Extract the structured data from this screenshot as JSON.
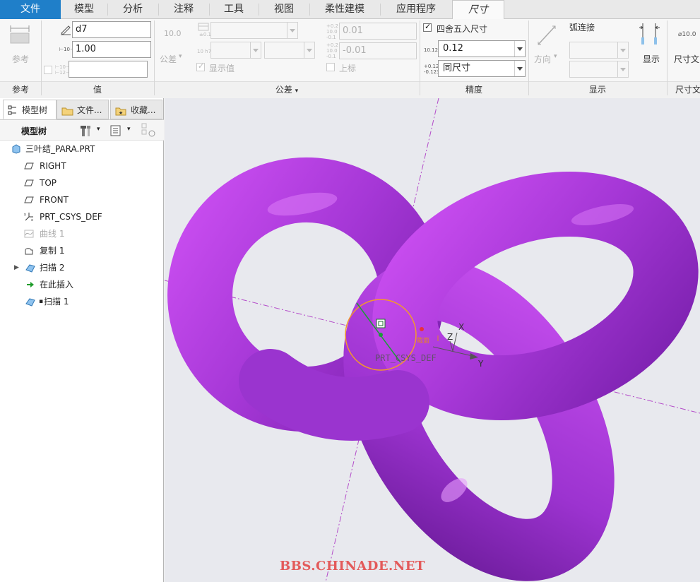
{
  "menubar": {
    "tabs": [
      "文件",
      "模型",
      "分析",
      "注释",
      "工具",
      "视图",
      "柔性建模",
      "应用程序",
      "尺寸"
    ],
    "active": "尺寸",
    "accent": "#1f7fc9"
  },
  "ribbon": {
    "reference": {
      "label": "参考",
      "group": "参考"
    },
    "value": {
      "group": "值",
      "name_field": "d7",
      "value_field": "1.00",
      "name_prefix": "",
      "value_prefix": "⊢10⊣",
      "bottom_prefix": "⊢10⊣ ⊢12⊣",
      "bottom_field": ""
    },
    "tolerance": {
      "group": "公差",
      "sample_value": "10.0",
      "dropdown": "公差",
      "table_label": "±0.1",
      "hole_label": "10 h7",
      "upper_prefix": "+0.2 10.0 -0.1",
      "upper_value": "0.01",
      "lower_prefix": "+0.2 10.0 -0.1",
      "lower_value": "-0.01",
      "show_value": "显示值",
      "upper_check": "上标"
    },
    "precision": {
      "group": "精度",
      "round_label": "四舍五入尺寸",
      "round_checked": true,
      "decimal_prefix": "10.123",
      "decimal_value": "0.12",
      "tol_prefix": "+0.123 -0.123",
      "tol_value": "同尺寸"
    },
    "display": {
      "group": "显示",
      "direction_label": "方向",
      "arc_label": "弧连接",
      "show_label": "显示"
    },
    "dim_text": {
      "group": "尺寸文",
      "label": "尺寸文",
      "prefix": "⌀10.0"
    }
  },
  "left_pane": {
    "tabs": [
      "模型树",
      "文件...",
      "收藏..."
    ],
    "tree_header": "模型树",
    "items": [
      {
        "label": "三叶结_PARA.PRT",
        "icon": "part-icon",
        "disabled": false,
        "expand": false
      },
      {
        "label": "RIGHT",
        "icon": "datum-plane-icon",
        "disabled": false,
        "expand": false
      },
      {
        "label": "TOP",
        "icon": "datum-plane-icon",
        "disabled": false,
        "expand": false
      },
      {
        "label": "FRONT",
        "icon": "datum-plane-icon",
        "disabled": false,
        "expand": false
      },
      {
        "label": "PRT_CSYS_DEF",
        "icon": "csys-icon",
        "disabled": false,
        "expand": false
      },
      {
        "label": "曲线 1",
        "icon": "curve-icon",
        "disabled": true,
        "expand": false
      },
      {
        "label": "复制 1",
        "icon": "copy-icon",
        "disabled": false,
        "expand": false
      },
      {
        "label": "扫描 2",
        "icon": "sweep-icon",
        "disabled": false,
        "expand": true
      },
      {
        "label": "在此插入",
        "icon": "insert-arrow-icon",
        "disabled": false,
        "expand": false
      },
      {
        "label": "扫描 1",
        "icon": "sweep-icon",
        "disabled": false,
        "expand": false
      }
    ]
  },
  "viewport": {
    "csys_label": "PRT_CSYS_DEF",
    "axis_x": "X",
    "axis_y": "Y",
    "axis_z": "Z",
    "small_tag": "截面",
    "watermark": "BBS.CHINADE.NET",
    "knot_color": "#a43ad8",
    "background": "#e8e9ee"
  }
}
